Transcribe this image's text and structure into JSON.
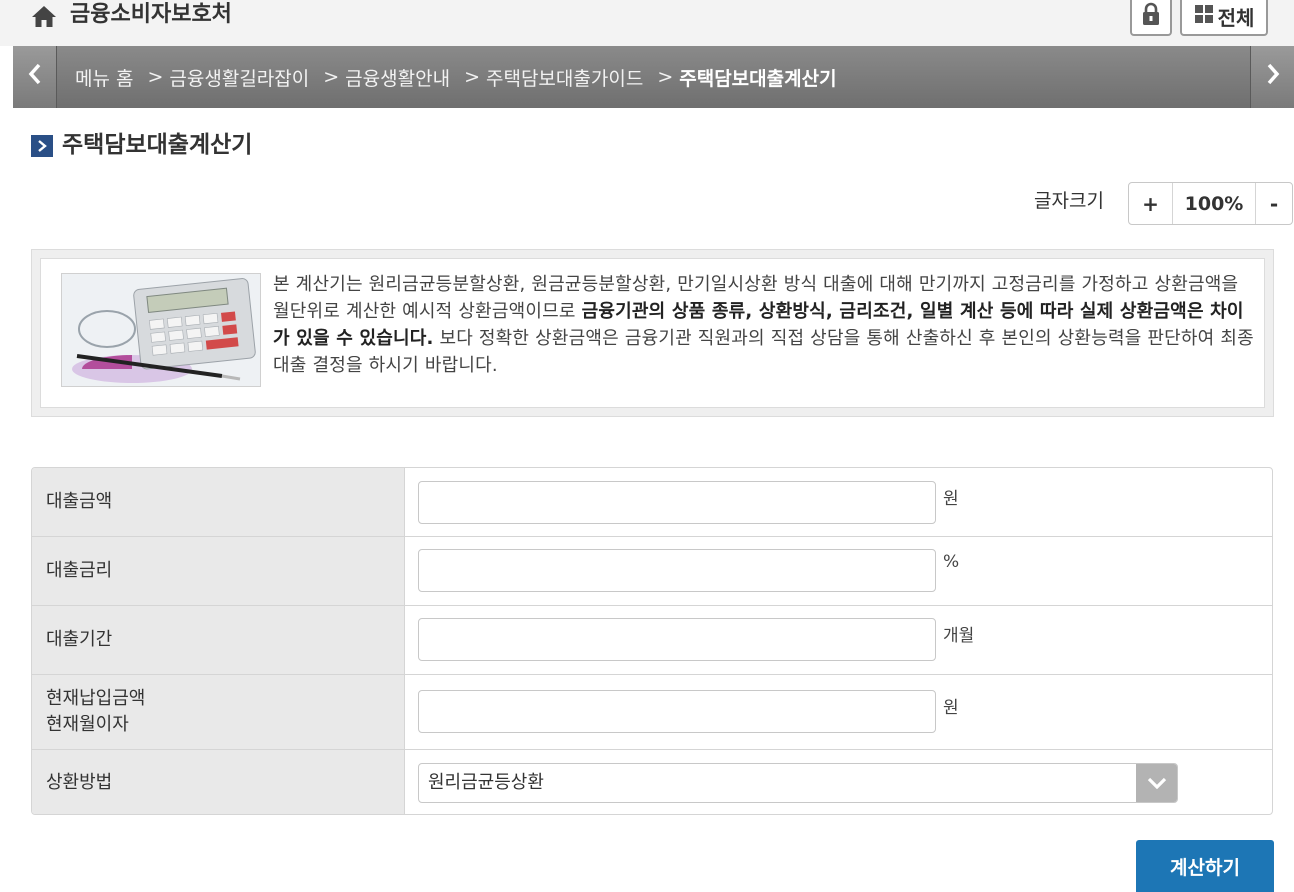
{
  "header": {
    "site_title": "금융소비자보호처",
    "all_menu_label": "전체",
    "home_icon": "home-icon",
    "lock_icon": "lock-icon",
    "grid_icon": "grid-icon"
  },
  "breadcrumb": {
    "items": [
      "메뉴 홈",
      "금융생활길라잡이",
      "금융생활안내",
      "주택담보대출가이드",
      "주택담보대출계산기"
    ],
    "prev_icon": "chevron-left-icon",
    "next_icon": "chevron-right-icon"
  },
  "page": {
    "title": "주택담보대출계산기",
    "title_mark_icon": "chevron-right-icon"
  },
  "font_size": {
    "label": "글자크기",
    "plus": "+",
    "value": "100%",
    "minus": "-"
  },
  "info": {
    "image": "calculator-photo",
    "text_part1": "본 계산기는 원리금균등분할상환, 원금균등분할상환, 만기일시상환 방식 대출에 대해 만기까지 고정금리를 가정하고 상환금액을 월단위로 계산한 예시적 상환금액이므로 ",
    "text_bold": "금융기관의 상품 종류, 상환방식, 금리조건, 일별 계산 등에 따라 실제 상환금액은 차이가 있을 수 있습니다.",
    "text_part2": " 보다 정확한 상환금액은 금융기관 직원과의 직접 상담을 통해 산출하신 후 본인의 상환능력을 판단하여 최종 대출 결정을 하시기 바랍니다."
  },
  "form": {
    "loan_amount": {
      "label": "대출금액",
      "value": "",
      "unit": "원"
    },
    "loan_rate": {
      "label": "대출금리",
      "value": "",
      "unit": "%"
    },
    "loan_period": {
      "label": "대출기간",
      "value": "",
      "unit": "개월"
    },
    "current_payment": {
      "label_line1": "현재납입금액",
      "label_line2": "현재월이자",
      "value": "",
      "unit": "원"
    },
    "repay_method": {
      "label": "상환방법",
      "selected": "원리금균등상환"
    }
  },
  "submit_label": "계산하기",
  "colors": {
    "accent": "#1d76b5",
    "title_mark": "#2a4f86",
    "nav_bg": "#7a7a7a"
  }
}
